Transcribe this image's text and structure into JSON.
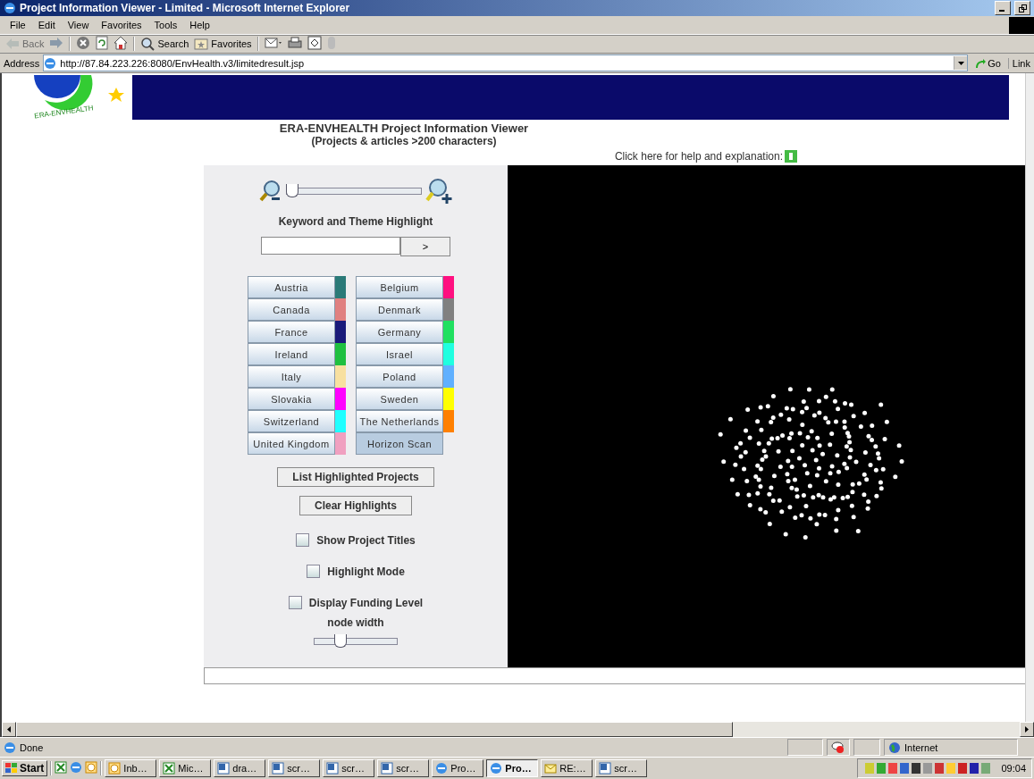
{
  "window": {
    "title": "Project Information Viewer - Limited - Microsoft Internet Explorer"
  },
  "menu": [
    "File",
    "Edit",
    "View",
    "Favorites",
    "Tools",
    "Help"
  ],
  "toolbar": [
    {
      "kind": "back",
      "label": "Back",
      "disabled": true
    },
    {
      "kind": "forward",
      "disabled": false
    },
    {
      "kind": "stop"
    },
    {
      "kind": "refresh"
    },
    {
      "kind": "home"
    },
    {
      "kind": "search",
      "label": "Search"
    },
    {
      "kind": "favorites",
      "label": "Favorites"
    },
    {
      "kind": "mail"
    },
    {
      "kind": "print"
    },
    {
      "kind": "edit"
    },
    {
      "kind": "messenger"
    }
  ],
  "address": {
    "label": "Address",
    "value": "http://87.84.223.226:8080/EnvHealth.v3/limitedresult.jsp",
    "go": "Go",
    "links": "Link"
  },
  "page": {
    "logo_text": "ERA-ENVHEALTH",
    "title": "ERA-ENVHEALTH Project Information Viewer",
    "subtitle": "(Projects & articles >200 characters)",
    "help_link": "Click here for help and explanation:",
    "zoom_slider": {
      "level": 0.03
    },
    "highlight_label": "Keyword and Theme Highlight",
    "go_button": ">",
    "countries": [
      {
        "label": "Austria",
        "color": "#2a7a78"
      },
      {
        "label": "Belgium",
        "color": "#ff1080"
      },
      {
        "label": "Canada",
        "color": "#e08080"
      },
      {
        "label": "Denmark",
        "color": "#808080"
      },
      {
        "label": "France",
        "color": "#1a1a7a"
      },
      {
        "label": "Germany",
        "color": "#20e060"
      },
      {
        "label": "Ireland",
        "color": "#20c040"
      },
      {
        "label": "Israel",
        "color": "#20ffe0"
      },
      {
        "label": "Italy",
        "color": "#f8e0a0"
      },
      {
        "label": "Poland",
        "color": "#60b0ff"
      },
      {
        "label": "Slovakia",
        "color": "#ff00ff"
      },
      {
        "label": "Sweden",
        "color": "#ffff00"
      },
      {
        "label": "Switzerland",
        "color": "#20ffff"
      },
      {
        "label": "The Netherlands",
        "color": "#ff8000"
      },
      {
        "label": "United Kingdom",
        "color": "#f0a0c0"
      },
      {
        "label": "Horizon Scan",
        "selected": true
      }
    ],
    "buttons": [
      "List Highlighted Projects",
      "Clear Highlights"
    ],
    "options": [
      {
        "label": "Show Project Titles",
        "checked": false
      },
      {
        "label": "Highlight Mode",
        "checked": false
      },
      {
        "label": "Display Funding Level",
        "checked": false
      }
    ],
    "node_width": {
      "label": "node width",
      "level": 0.3
    }
  },
  "status": {
    "text": "Done",
    "zone": "Internet"
  },
  "taskbar": {
    "start": "Start",
    "tasks": [
      {
        "label": "Inb…",
        "kind": "outlook",
        "selected": false
      },
      {
        "label": "Mic…",
        "kind": "excel",
        "selected": false
      },
      {
        "label": "dra…",
        "kind": "word",
        "selected": false
      },
      {
        "label": "scr…",
        "kind": "word",
        "selected": false
      },
      {
        "label": "scr…",
        "kind": "word",
        "selected": false
      },
      {
        "label": "scr…",
        "kind": "word",
        "selected": false
      },
      {
        "label": "Pro…",
        "kind": "ie",
        "selected": false
      },
      {
        "label": "Pro…",
        "kind": "ie",
        "selected": true
      },
      {
        "label": "RE:…",
        "kind": "mail",
        "selected": false
      },
      {
        "label": "scr…",
        "kind": "word",
        "selected": false
      }
    ],
    "clock": "09:04"
  }
}
